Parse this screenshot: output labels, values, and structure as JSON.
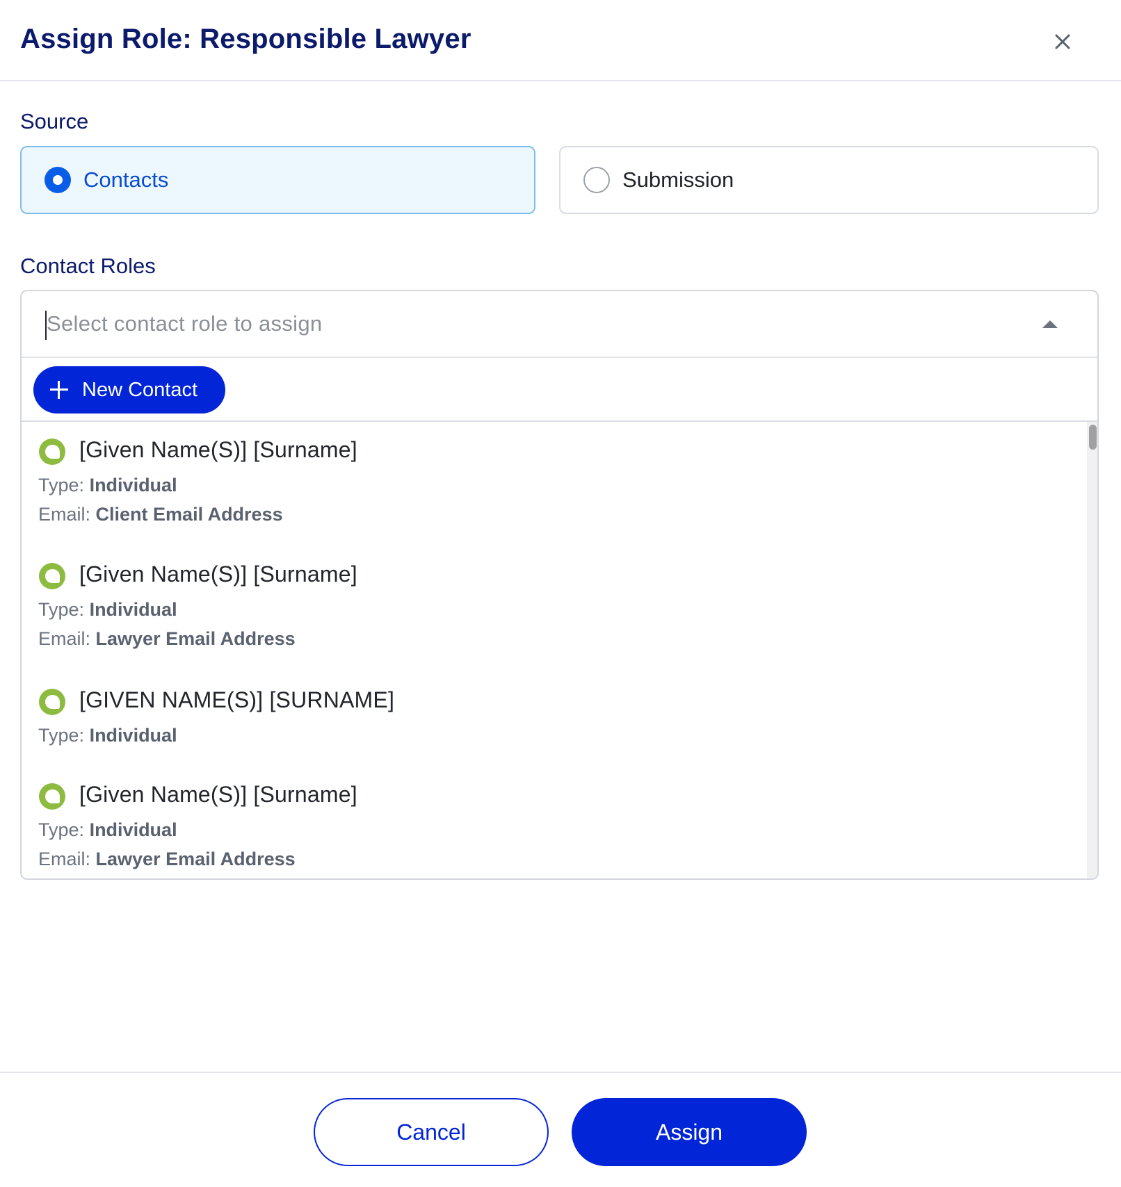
{
  "dialog": {
    "title": "Assign Role: Responsible Lawyer",
    "close_icon": "close-icon"
  },
  "source": {
    "label": "Source",
    "options": [
      {
        "label": "Contacts",
        "selected": true
      },
      {
        "label": "Submission",
        "selected": false
      }
    ]
  },
  "contact_roles": {
    "label": "Contact Roles",
    "placeholder": "Select contact role to assign",
    "dropdown_icon": "chevron-up-icon",
    "new_contact_label": "New Contact",
    "type_key": "Type:",
    "email_key": "Email:",
    "items": [
      {
        "name": "[Given Name(S)] [Surname]",
        "type": "Individual",
        "email": "Client Email Address"
      },
      {
        "name": "[Given Name(S)] [Surname]",
        "type": "Individual",
        "email": "Lawyer Email Address"
      },
      {
        "name": "[GIVEN NAME(S)] [SURNAME]",
        "type": "Individual",
        "email": null
      },
      {
        "name": "[Given Name(S)] [Surname]",
        "type": "Individual",
        "email": "Lawyer Email Address"
      }
    ]
  },
  "footer": {
    "cancel_label": "Cancel",
    "assign_label": "Assign"
  },
  "colors": {
    "title": "#0b1a6b",
    "primary": "#0325d8",
    "radio_selected": "#0a5de6",
    "selected_card_bg": "#ecf8fd",
    "avatar": "#8dbb3f"
  }
}
